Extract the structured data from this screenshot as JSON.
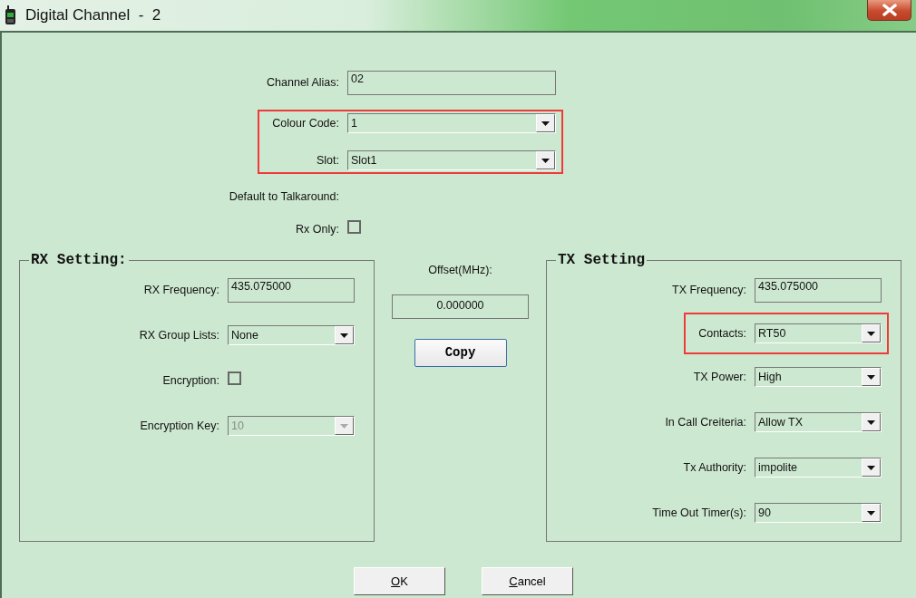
{
  "window": {
    "title": "Digital Channel  -  2"
  },
  "general": [
    {
      "kind": "text",
      "label": "Channel Alias:",
      "value": "02",
      "highlighted": false
    },
    {
      "kind": "select",
      "label": "Colour Code:",
      "value": "1",
      "highlighted": true
    },
    {
      "kind": "select",
      "label": "Slot:",
      "value": "Slot1",
      "highlighted": true
    },
    {
      "kind": "caption",
      "label": "Default to Talkaround:",
      "highlighted": false
    },
    {
      "kind": "checkbox",
      "label": "Rx Only:",
      "checked": false,
      "highlighted": false
    }
  ],
  "rx_setting": {
    "title": "RX Setting:",
    "fields": [
      {
        "kind": "text",
        "label": "RX Frequency:",
        "value": "435.075000",
        "highlighted": false,
        "disabled": false
      },
      {
        "kind": "select",
        "label": "RX Group Lists:",
        "value": "None",
        "highlighted": false,
        "disabled": false
      },
      {
        "kind": "checkbox",
        "label": "Encryption:",
        "checked": false,
        "highlighted": false,
        "disabled": false
      },
      {
        "kind": "select",
        "label": "Encryption Key:",
        "value": "10",
        "highlighted": false,
        "disabled": true
      }
    ]
  },
  "offset": {
    "label": "Offset(MHz):",
    "value": "0.000000",
    "button": "Copy"
  },
  "tx_setting": {
    "title": "TX Setting",
    "fields": [
      {
        "kind": "text",
        "label": "TX Frequency:",
        "value": "435.075000",
        "highlighted": false,
        "disabled": false
      },
      {
        "kind": "select",
        "label": "Contacts:",
        "value": "RT50",
        "highlighted": true,
        "disabled": false
      },
      {
        "kind": "select",
        "label": "TX Power:",
        "value": "High",
        "highlighted": false,
        "disabled": false
      },
      {
        "kind": "select",
        "label": "In Call Creiteria:",
        "value": "Allow TX",
        "highlighted": false,
        "disabled": false
      },
      {
        "kind": "select",
        "label": "Tx Authority:",
        "value": "impolite",
        "highlighted": false,
        "disabled": false
      },
      {
        "kind": "select",
        "label": "Time Out Timer(s):",
        "value": "90",
        "highlighted": false,
        "disabled": false
      }
    ]
  },
  "buttons": [
    {
      "label": "OK",
      "mnemonic_underlined": true
    },
    {
      "label": "Cancel",
      "mnemonic_underlined": true
    }
  ]
}
